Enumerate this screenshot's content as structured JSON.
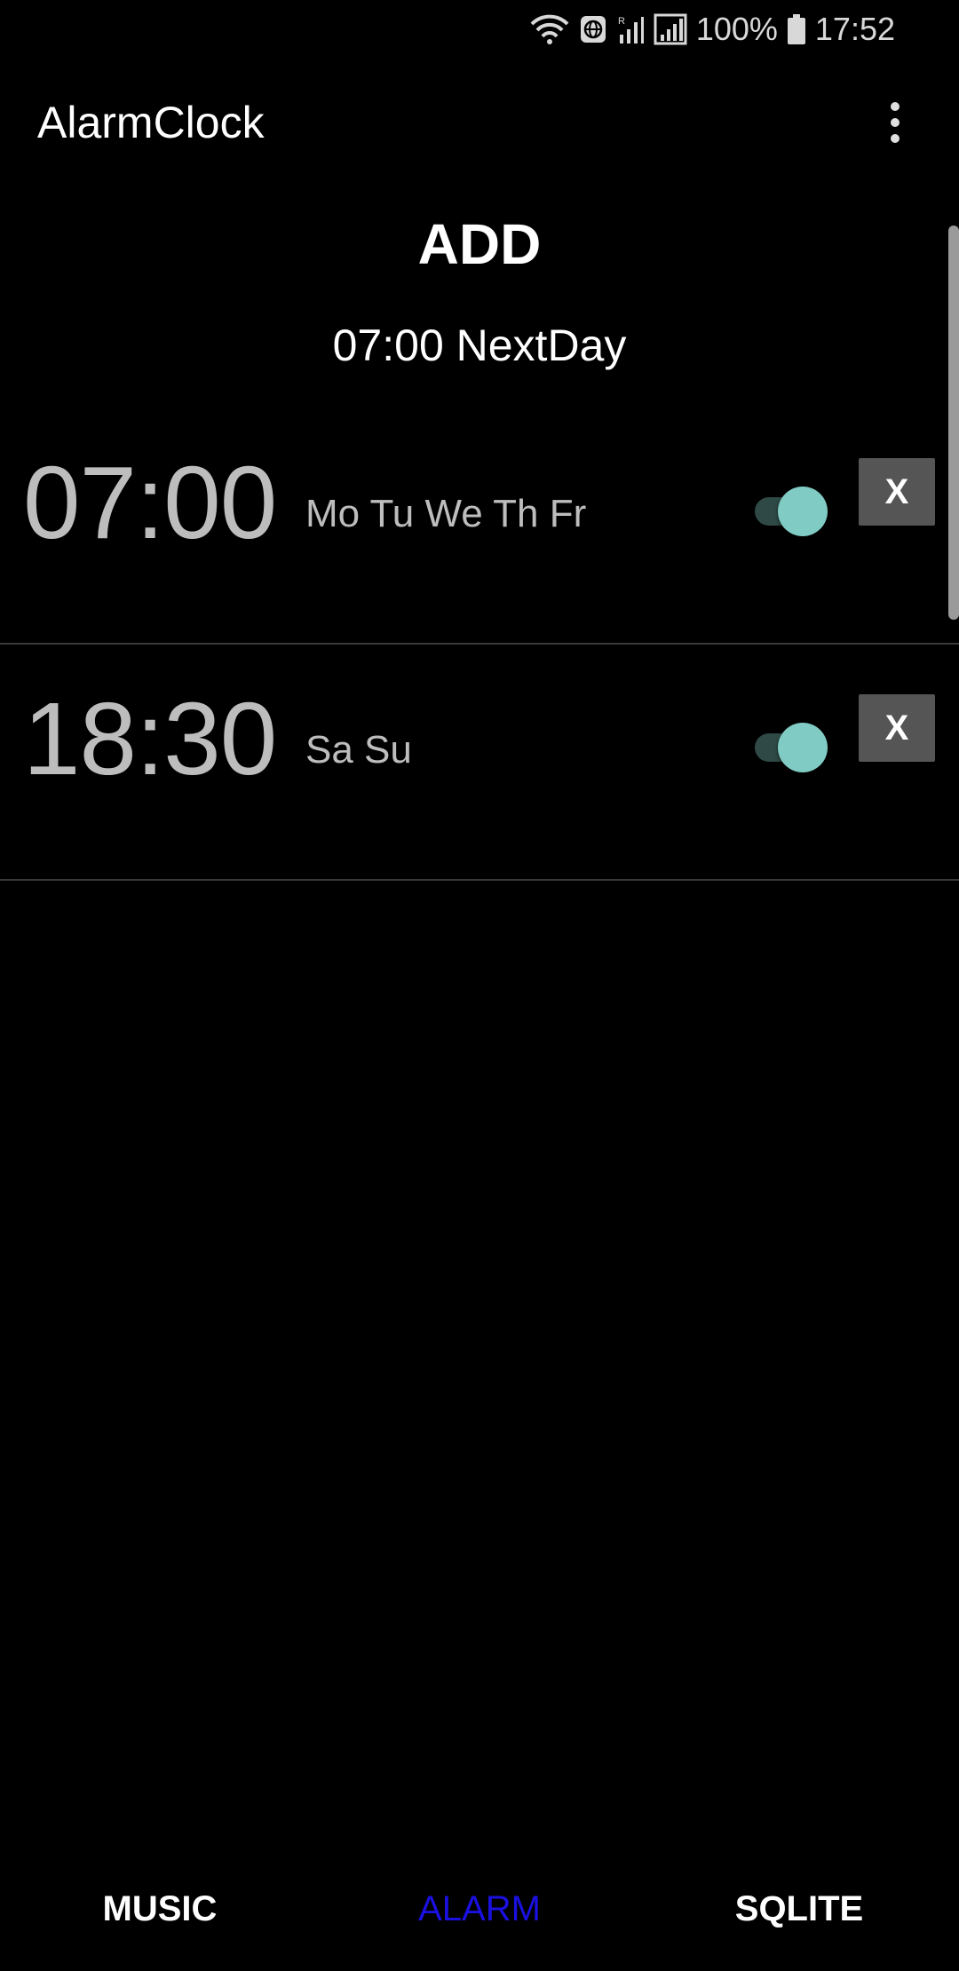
{
  "status_bar": {
    "battery_percent": "100%",
    "time": "17:52",
    "icons": [
      "wifi-icon",
      "vpn-globe-icon",
      "signal-r-icon",
      "signal-icon",
      "battery-icon"
    ]
  },
  "app_bar": {
    "title": "AlarmClock",
    "overflow_icon": "more-vert-icon"
  },
  "header": {
    "add_label": "ADD",
    "next_alarm": "07:00 NextDay"
  },
  "alarms": [
    {
      "time": "07:00",
      "days": "Mo Tu We Th Fr",
      "enabled": true,
      "delete_label": "X"
    },
    {
      "time": "18:30",
      "days": "Sa Su",
      "enabled": true,
      "delete_label": "X"
    }
  ],
  "bottom_nav": {
    "items": [
      {
        "label": "MUSIC",
        "active": false
      },
      {
        "label": "ALARM",
        "active": true
      },
      {
        "label": "SQLITE",
        "active": false
      }
    ]
  },
  "colors": {
    "background": "#000000",
    "toggle_thumb": "#80cbc4",
    "toggle_track": "#2f4a46",
    "active_tab": "#1a10e0",
    "delete_button": "#555555",
    "alarm_text": "#bdbdbd"
  }
}
